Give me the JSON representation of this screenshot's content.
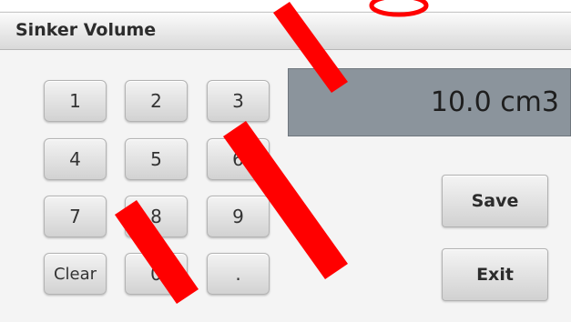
{
  "header": {
    "title": "Sinker Volume"
  },
  "display": {
    "value": "10.0 cm3"
  },
  "keypad": {
    "keys": [
      "1",
      "2",
      "3",
      "4",
      "5",
      "6",
      "7",
      "8",
      "9",
      "Clear",
      "0",
      "."
    ]
  },
  "actions": {
    "save_label": "Save",
    "exit_label": "Exit"
  },
  "colors": {
    "display_background": "#8b949c",
    "watermark": "#ff0000"
  }
}
